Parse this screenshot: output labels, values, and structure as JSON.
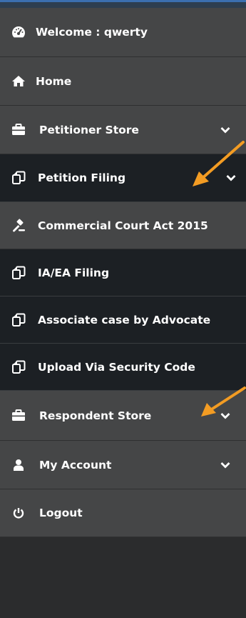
{
  "menu": {
    "welcome": "Welcome : qwerty",
    "home": "Home",
    "petitioner_store": "Petitioner Store",
    "petition_filing": "Petition Filing",
    "commercial_court": "Commercial Court Act 2015",
    "ia_ea_filing": "IA/EA Filing",
    "associate_case": "Associate case by Advocate",
    "upload_security": "Upload Via Security Code",
    "respondent_store": "Respondent Store",
    "my_account": "My Account",
    "logout": "Logout"
  },
  "icons": {
    "welcome": "dashboard-icon",
    "home": "home-icon",
    "petitioner_store": "briefcase-icon",
    "petition_filing": "copy-icon",
    "commercial_court": "gavel-icon",
    "ia_ea_filing": "copy-icon",
    "associate_case": "copy-icon",
    "upload_security": "copy-icon",
    "respondent_store": "briefcase-icon",
    "my_account": "user-icon",
    "logout": "power-icon",
    "annotation_arrow": "orange-arrow"
  },
  "colors": {
    "sidebar_gray": "#454647",
    "sidebar_dark": "#1c2024",
    "text": "#ffffff",
    "arrow": "#f39c23"
  }
}
